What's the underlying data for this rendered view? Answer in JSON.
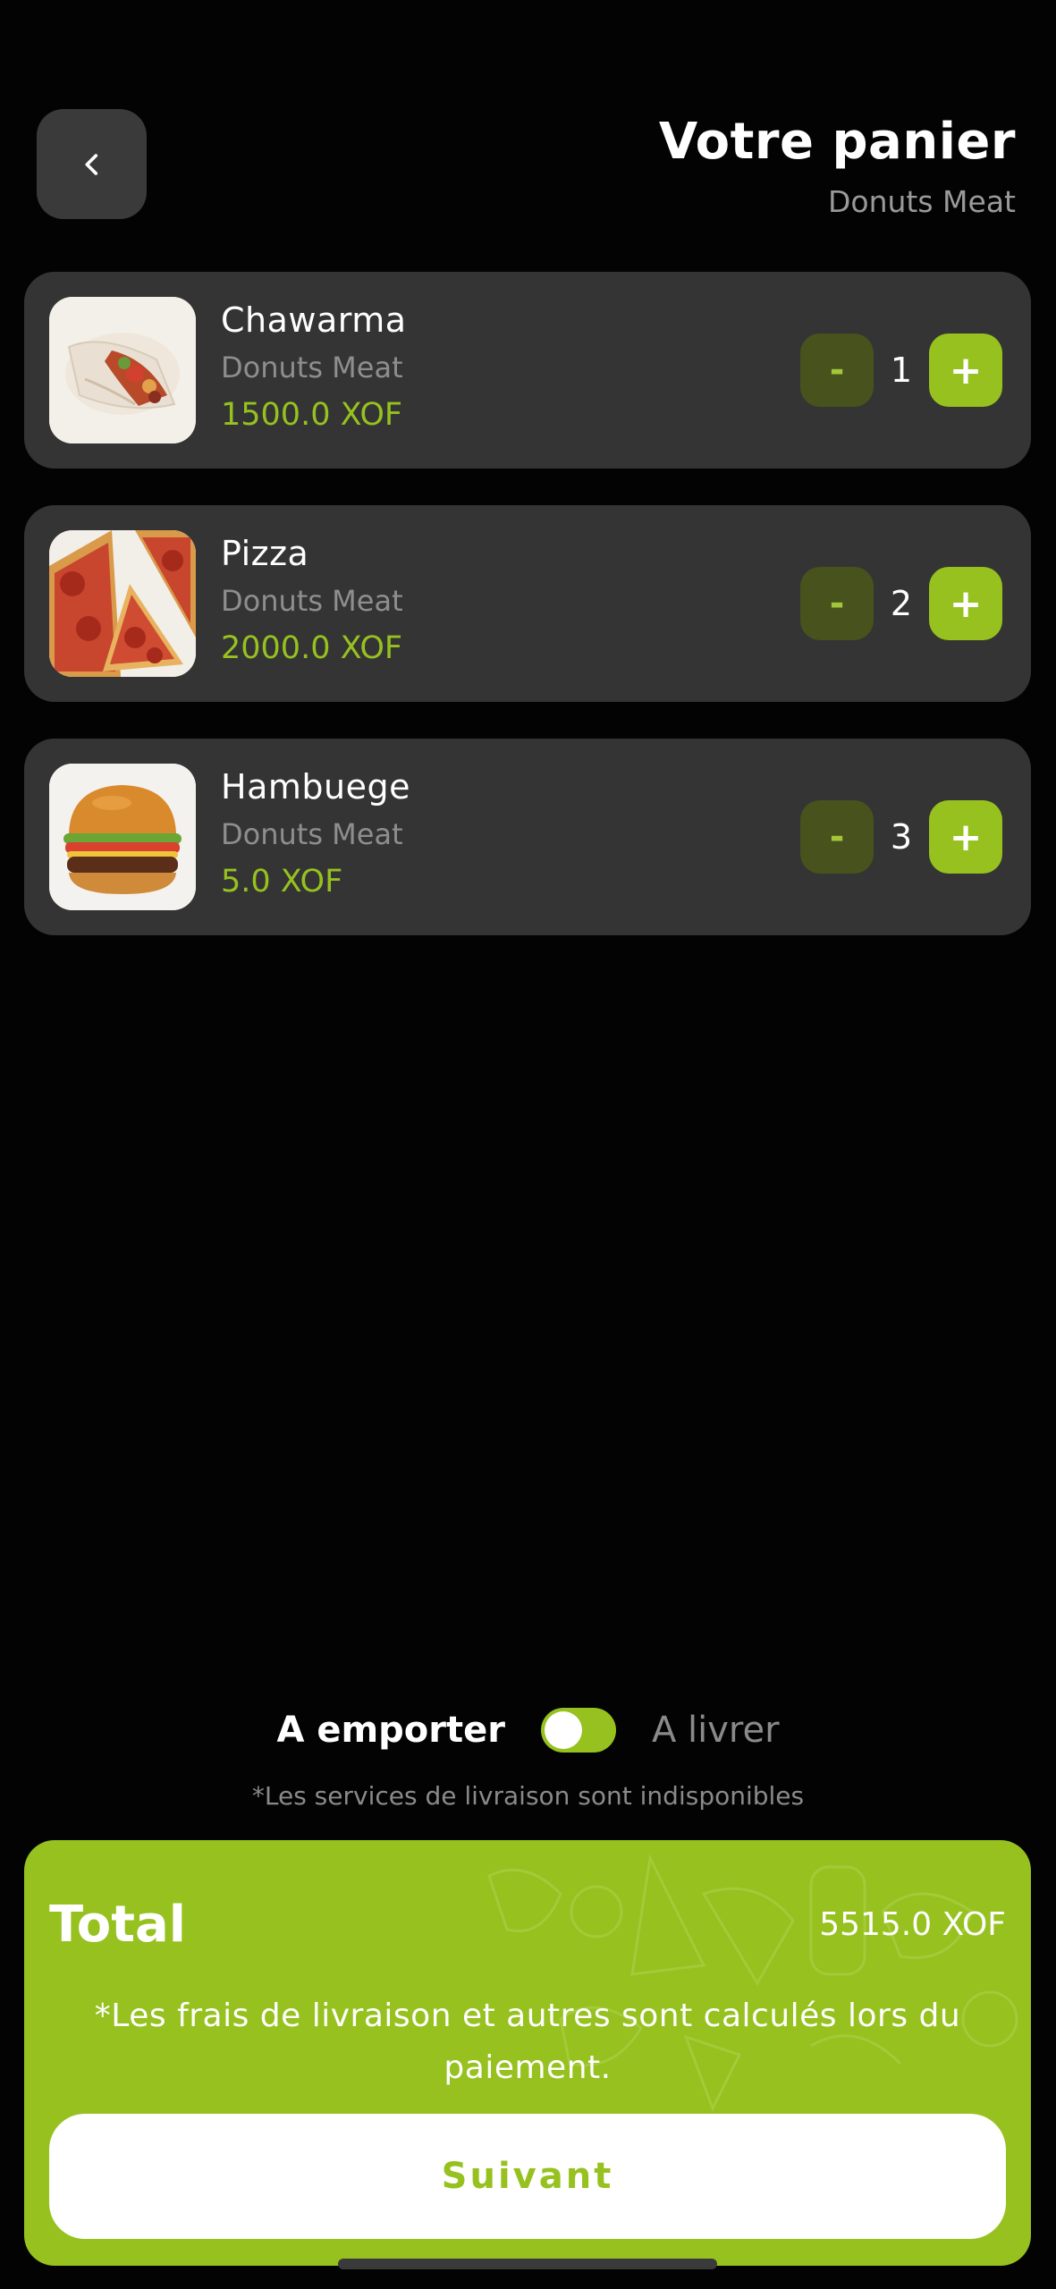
{
  "header": {
    "title": "Votre panier",
    "subtitle": "Donuts Meat",
    "back_icon": "chevron-left-icon"
  },
  "cart": {
    "items": [
      {
        "name": "Chawarma",
        "shop": "Donuts Meat",
        "price": "1500.0 XOF",
        "quantity": "1",
        "minus": "-",
        "plus": "+"
      },
      {
        "name": "Pizza",
        "shop": "Donuts Meat",
        "price": "2000.0 XOF",
        "quantity": "2",
        "minus": "-",
        "plus": "+"
      },
      {
        "name": "Hambuege",
        "shop": "Donuts Meat",
        "price": "5.0 XOF",
        "quantity": "3",
        "minus": "-",
        "plus": "+"
      }
    ]
  },
  "delivery": {
    "option_left": "A emporter",
    "option_right": "A livrer",
    "toggle_on": true,
    "notice": "*Les services de livraison sont indisponibles"
  },
  "summary": {
    "total_label": "Total",
    "total_value": "5515.0 XOF",
    "fees_note": "*Les frais de livraison et autres sont calculés lors du paiement.",
    "next_button": "Suivant"
  },
  "colors": {
    "accent": "#96c11f",
    "card": "#343434",
    "background": "#030303"
  }
}
